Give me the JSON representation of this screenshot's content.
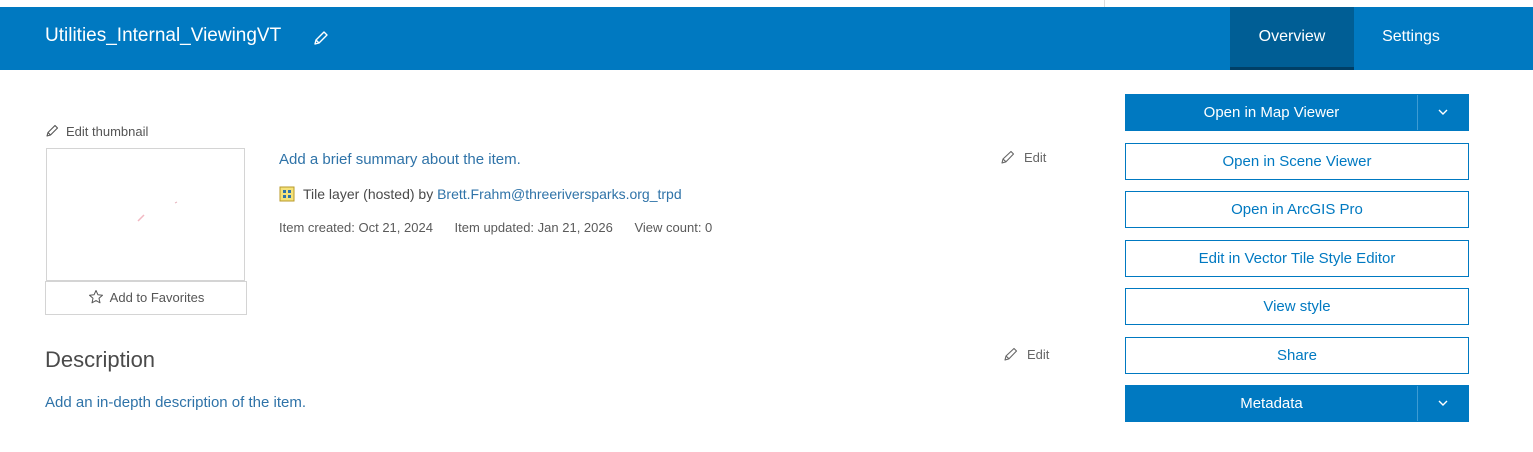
{
  "header": {
    "title": "Utilities_Internal_ViewingVT",
    "tabs": [
      {
        "label": "Overview",
        "active": true
      },
      {
        "label": "Settings",
        "active": false
      }
    ],
    "color": "#0079c1"
  },
  "thumbnail": {
    "edit_label": "Edit thumbnail",
    "favorites_label": "Add to Favorites"
  },
  "summary": {
    "text": "Add a brief summary about the item.",
    "edit_label": "Edit"
  },
  "item": {
    "type_text": "Tile layer (hosted) by",
    "owner": "Brett.Frahm@threeriversparks.org_trpd",
    "created": "Item created: Oct 21, 2024",
    "updated": "Item updated: Jan 21, 2026",
    "view_count": "View count: 0"
  },
  "description": {
    "heading": "Description",
    "text": "Add an in-depth description of the item.",
    "edit_label": "Edit"
  },
  "actions": {
    "open_map_viewer": "Open in Map Viewer",
    "open_scene_viewer": "Open in Scene Viewer",
    "open_arcgis_pro": "Open in ArcGIS Pro",
    "edit_vector_tile": "Edit in Vector Tile Style Editor",
    "view_style": "View style",
    "share": "Share",
    "metadata": "Metadata"
  }
}
